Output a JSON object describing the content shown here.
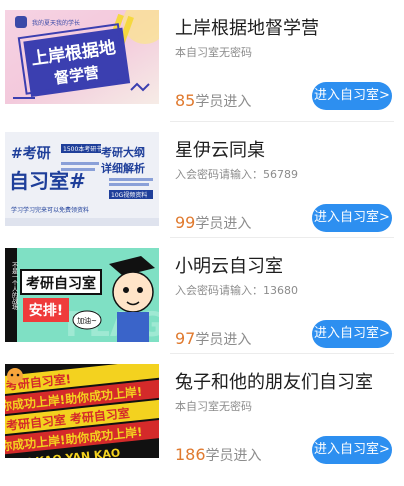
{
  "items": [
    {
      "title": "上岸根据地督学营",
      "desc": "本自习室无密码",
      "count": "85",
      "count_suffix": "学员进入",
      "button": "进入自习室>",
      "thumb": {
        "small": "我的夏天我的学长",
        "line1": "上岸根据地",
        "line2": "督学营"
      }
    },
    {
      "title": "星伊云同桌",
      "desc": "入会密码请输入：56789",
      "count": "99",
      "count_suffix": "学员进入",
      "button": "进入自习室>",
      "thumb": {
        "line1": "#考研",
        "line2": "自习室#",
        "tag": "1500本考研书",
        "right1": "考研大纲",
        "right2": "详细解析",
        "badge": "10G视频资料",
        "footer": "学习学习完来可以免费领资料"
      }
    },
    {
      "title": "小明云自习室",
      "desc": "入会密码请输入：13680",
      "count": "97",
      "count_suffix": "学员进入",
      "button": "进入自习室>",
      "thumb": {
        "side": "不是一个人的战场",
        "line1": "考研自习室",
        "line2": "安排!",
        "bubble": "加油~",
        "bg": "FLAG"
      }
    },
    {
      "title": "兔子和他的朋友们自习室",
      "desc": "本自习室无密码",
      "count": "186",
      "count_suffix": "学员进入",
      "button": "进入自习室>",
      "thumb": {
        "r1": "考研自习室!",
        "r2": "你成功上岸!助你成功上岸!",
        "r3": "考研自习室 考研自习室",
        "r4": "你成功上岸!助你成功上岸!",
        "r5": "AN KAO YAN KAO"
      }
    }
  ]
}
